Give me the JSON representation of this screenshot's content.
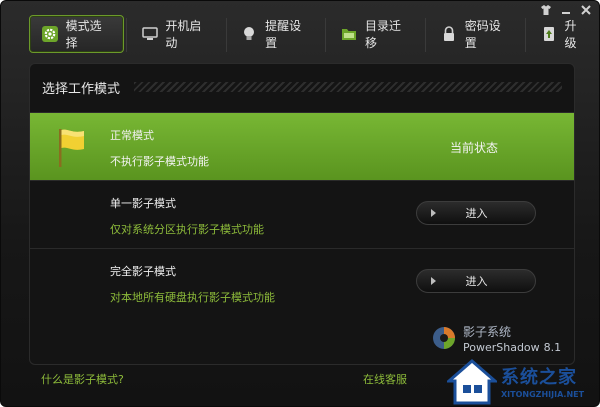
{
  "titlebar": {
    "menu_icon": "shirt-icon",
    "minimize": "minimize-icon",
    "close": "close-icon"
  },
  "tabs": [
    {
      "label": "模式选择",
      "icon": "gear-icon",
      "active": true
    },
    {
      "label": "开机启动",
      "icon": "monitor-icon",
      "active": false
    },
    {
      "label": "提醒设置",
      "icon": "lightbulb-icon",
      "active": false
    },
    {
      "label": "目录迁移",
      "icon": "folder-icon",
      "active": false
    },
    {
      "label": "密码设置",
      "icon": "lock-icon",
      "active": false
    },
    {
      "label": "升级",
      "icon": "upgrade-icon",
      "active": false
    }
  ],
  "panel": {
    "title": "选择工作模式"
  },
  "modes": [
    {
      "title": "正常模式",
      "desc": "不执行影子模式功能",
      "status": "当前状态"
    },
    {
      "title": "单一影子模式",
      "desc": "仅对系统分区执行影子模式功能",
      "button": "进入"
    },
    {
      "title": "完全影子模式",
      "desc": "对本地所有硬盘执行影子模式功能",
      "button": "进入"
    }
  ],
  "brand": {
    "name_cn": "影子系统",
    "name_en": "PowerShadow",
    "version": "8.1"
  },
  "footer": {
    "help_link": "什么是影子模式?",
    "support_link": "在线客服"
  },
  "watermark": {
    "title": "系统之家",
    "url": "XITONGZHIJIA.NET"
  },
  "colors": {
    "accent_green": "#6da52a",
    "link_green": "#8dbb3a"
  }
}
